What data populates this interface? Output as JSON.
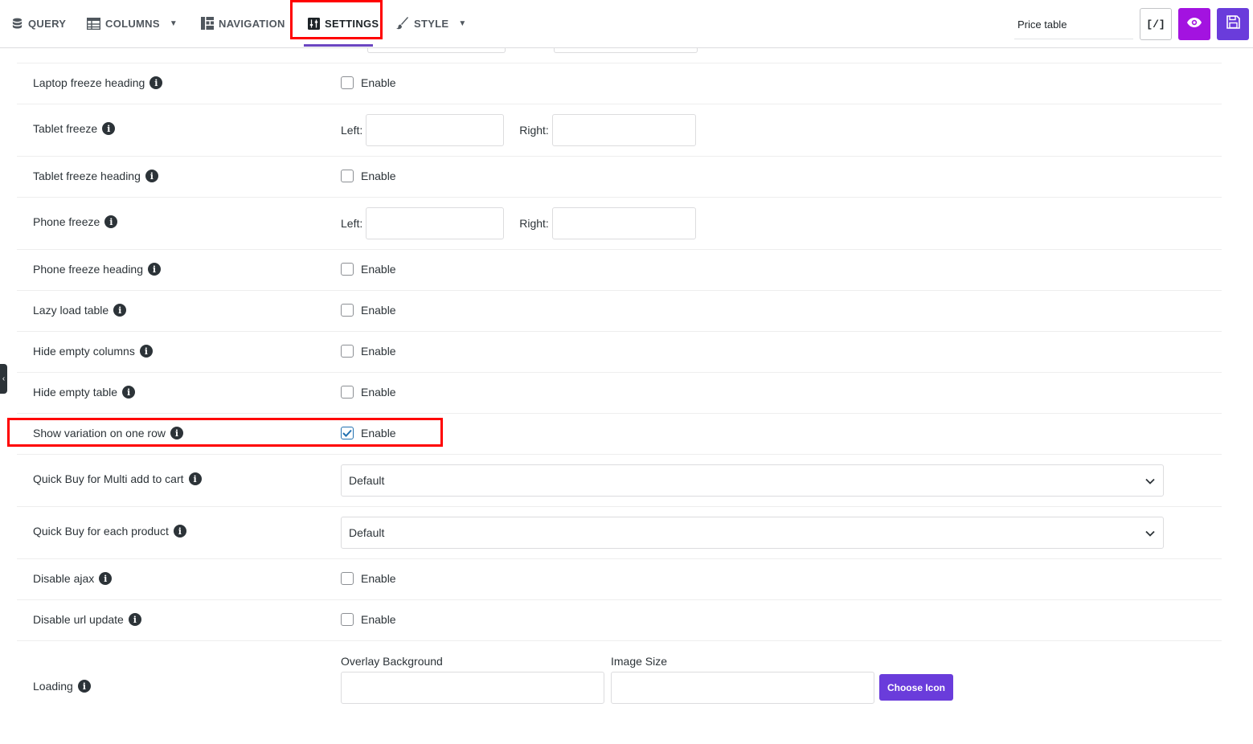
{
  "tabs": [
    {
      "label": "QUERY",
      "icon": "database-icon"
    },
    {
      "label": "COLUMNS",
      "icon": "table-icon",
      "dropdown": true
    },
    {
      "label": "NAVIGATION",
      "icon": "navigation-grid-icon"
    },
    {
      "label": "SETTINGS",
      "icon": "sliders-icon",
      "active": true
    },
    {
      "label": "STYLE",
      "icon": "brush-icon",
      "dropdown": true
    }
  ],
  "header": {
    "table_title": "Price table",
    "shortcode_label": "[/]",
    "preview_icon": "eye-icon",
    "save_icon": "floppy-disk-icon"
  },
  "colors": {
    "accent": "#6a3cdb",
    "preview": "#a313e0",
    "highlight": "#ff0000"
  },
  "rows": {
    "laptop_freeze_heading": {
      "label": "Laptop freeze heading",
      "option": "Enable",
      "checked": false
    },
    "tablet_freeze": {
      "label": "Tablet freeze",
      "left_label": "Left:",
      "right_label": "Right:"
    },
    "tablet_freeze_heading": {
      "label": "Tablet freeze heading",
      "option": "Enable",
      "checked": false
    },
    "phone_freeze": {
      "label": "Phone freeze",
      "left_label": "Left:",
      "right_label": "Right:"
    },
    "phone_freeze_heading": {
      "label": "Phone freeze heading",
      "option": "Enable",
      "checked": false
    },
    "lazy_load": {
      "label": "Lazy load table",
      "option": "Enable",
      "checked": false
    },
    "hide_empty_columns": {
      "label": "Hide empty columns",
      "option": "Enable",
      "checked": false
    },
    "hide_empty_table": {
      "label": "Hide empty table",
      "option": "Enable",
      "checked": false
    },
    "show_variation": {
      "label": "Show variation on one row",
      "option": "Enable",
      "checked": true
    },
    "quick_buy_multi": {
      "label": "Quick Buy for Multi add to cart",
      "value": "Default"
    },
    "quick_buy_each": {
      "label": "Quick Buy for each product",
      "value": "Default"
    },
    "disable_ajax": {
      "label": "Disable ajax",
      "option": "Enable",
      "checked": false
    },
    "disable_url_update": {
      "label": "Disable url update",
      "option": "Enable",
      "checked": false
    },
    "loading": {
      "label": "Loading",
      "overlay_label": "Overlay Background",
      "image_size_label": "Image Size",
      "choose_icon_label": "Choose Icon"
    }
  }
}
